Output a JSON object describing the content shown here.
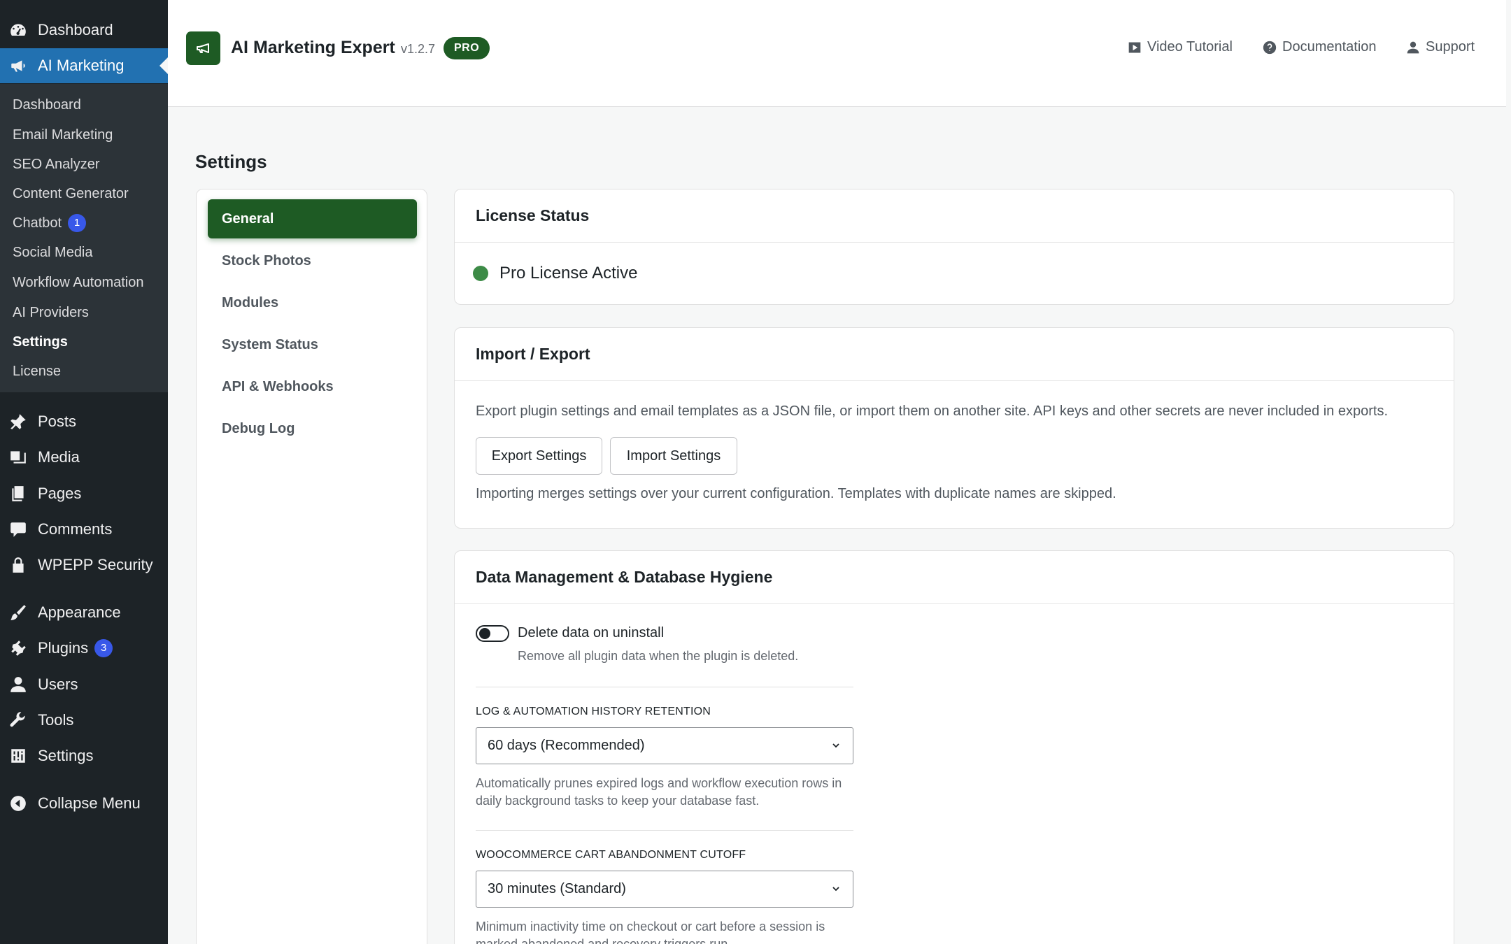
{
  "sidebar": {
    "top_items": [
      {
        "label": "Dashboard",
        "icon": "dashboard-icon"
      },
      {
        "label": "AI Marketing",
        "icon": "megaphone-icon"
      }
    ],
    "submenu": [
      {
        "label": "Dashboard"
      },
      {
        "label": "Email Marketing"
      },
      {
        "label": "SEO Analyzer"
      },
      {
        "label": "Content Generator"
      },
      {
        "label": "Chatbot",
        "badge": "1"
      },
      {
        "label": "Social Media"
      },
      {
        "label": "Workflow Automation"
      },
      {
        "label": "AI Providers"
      },
      {
        "label": "Settings"
      },
      {
        "label": "License"
      }
    ],
    "bottom_items": [
      {
        "label": "Posts",
        "icon": "pushpin-icon"
      },
      {
        "label": "Media",
        "icon": "media-icon"
      },
      {
        "label": "Pages",
        "icon": "pages-icon"
      },
      {
        "label": "Comments",
        "icon": "comment-icon"
      },
      {
        "label": "WPEPP Security",
        "icon": "lock-icon"
      },
      {
        "label": "Appearance",
        "icon": "brush-icon"
      },
      {
        "label": "Plugins",
        "icon": "plugin-icon",
        "badge": "3"
      },
      {
        "label": "Users",
        "icon": "user-icon"
      },
      {
        "label": "Tools",
        "icon": "wrench-icon"
      },
      {
        "label": "Settings",
        "icon": "settings-icon"
      },
      {
        "label": "Collapse Menu",
        "icon": "collapse-icon"
      }
    ]
  },
  "header": {
    "title": "AI Marketing Expert",
    "version": "v1.2.7",
    "badge": "PRO",
    "links": [
      {
        "label": "Video Tutorial",
        "icon": "video-icon"
      },
      {
        "label": "Documentation",
        "icon": "help-icon"
      },
      {
        "label": "Support",
        "icon": "user-icon"
      }
    ]
  },
  "page": {
    "title": "Settings"
  },
  "settings_nav": [
    "General",
    "Stock Photos",
    "Modules",
    "System Status",
    "API & Webhooks",
    "Debug Log"
  ],
  "license_card": {
    "title": "License Status",
    "status": "Pro License Active"
  },
  "import_export": {
    "title": "Import / Export",
    "description": "Export plugin settings and email templates as a JSON file, or import them on another site. API keys and other secrets are never included in exports.",
    "export_label": "Export Settings",
    "import_label": "Import Settings",
    "note": "Importing merges settings over your current configuration. Templates with duplicate names are skipped."
  },
  "data_management": {
    "title": "Data Management & Database Hygiene",
    "toggle_label": "Delete data on uninstall",
    "toggle_desc": "Remove all plugin data when the plugin is deleted.",
    "toggle_on": false,
    "retention_label": "Log & Automation History Retention",
    "retention_value": "60 days (Recommended)",
    "retention_help": "Automatically prunes expired logs and workflow execution rows in daily background tasks to keep your database fast.",
    "cutoff_label": "WooCommerce Cart Abandonment Cutoff",
    "cutoff_value": "30 minutes (Standard)",
    "cutoff_help": "Minimum inactivity time on checkout or cart before a session is marked abandoned and recovery triggers run."
  },
  "colors": {
    "brand_green": "#1e5b24",
    "status_green": "#3d8b47",
    "wp_blue": "#2271b1",
    "sidebar_bg": "#1d2327",
    "badge_blue": "#3858e9"
  }
}
